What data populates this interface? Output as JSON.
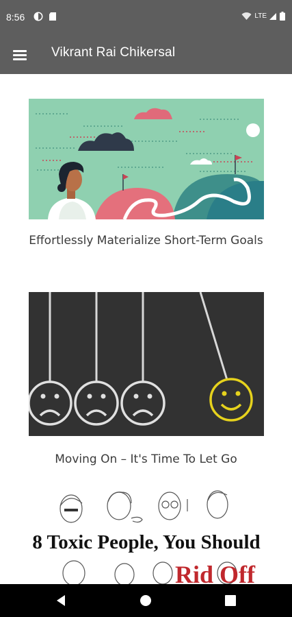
{
  "status_bar": {
    "time": "8:56",
    "network": "LTE",
    "icons": [
      "notification-app-icon",
      "sd-card-icon",
      "wifi-icon",
      "signal-icon",
      "battery-icon"
    ]
  },
  "app_bar": {
    "title": "Vikrant Rai Chikersal",
    "menu_icon": "hamburger-menu-icon"
  },
  "posts": [
    {
      "title": "Effortlessly Materialize Short-Term Goals",
      "image": "goal-illustration"
    },
    {
      "title": "Moving On – It's Time To Let Go",
      "image": "sad-happy-faces-chalkboard"
    },
    {
      "title": "",
      "image": "toxic-people-sketch",
      "image_text_line1": "8 Toxic People, You Should",
      "image_text_line2": "Rid Off"
    }
  ],
  "nav_bar": {
    "icons": [
      "back-icon",
      "home-icon",
      "recents-icon"
    ]
  },
  "colors": {
    "app_bar": "#5e5e5e",
    "goal_bg": "#8fd0b0",
    "chalkboard": "#2e2e2e",
    "smiley": "#e6d21d",
    "toxic_red": "#c0282d"
  }
}
